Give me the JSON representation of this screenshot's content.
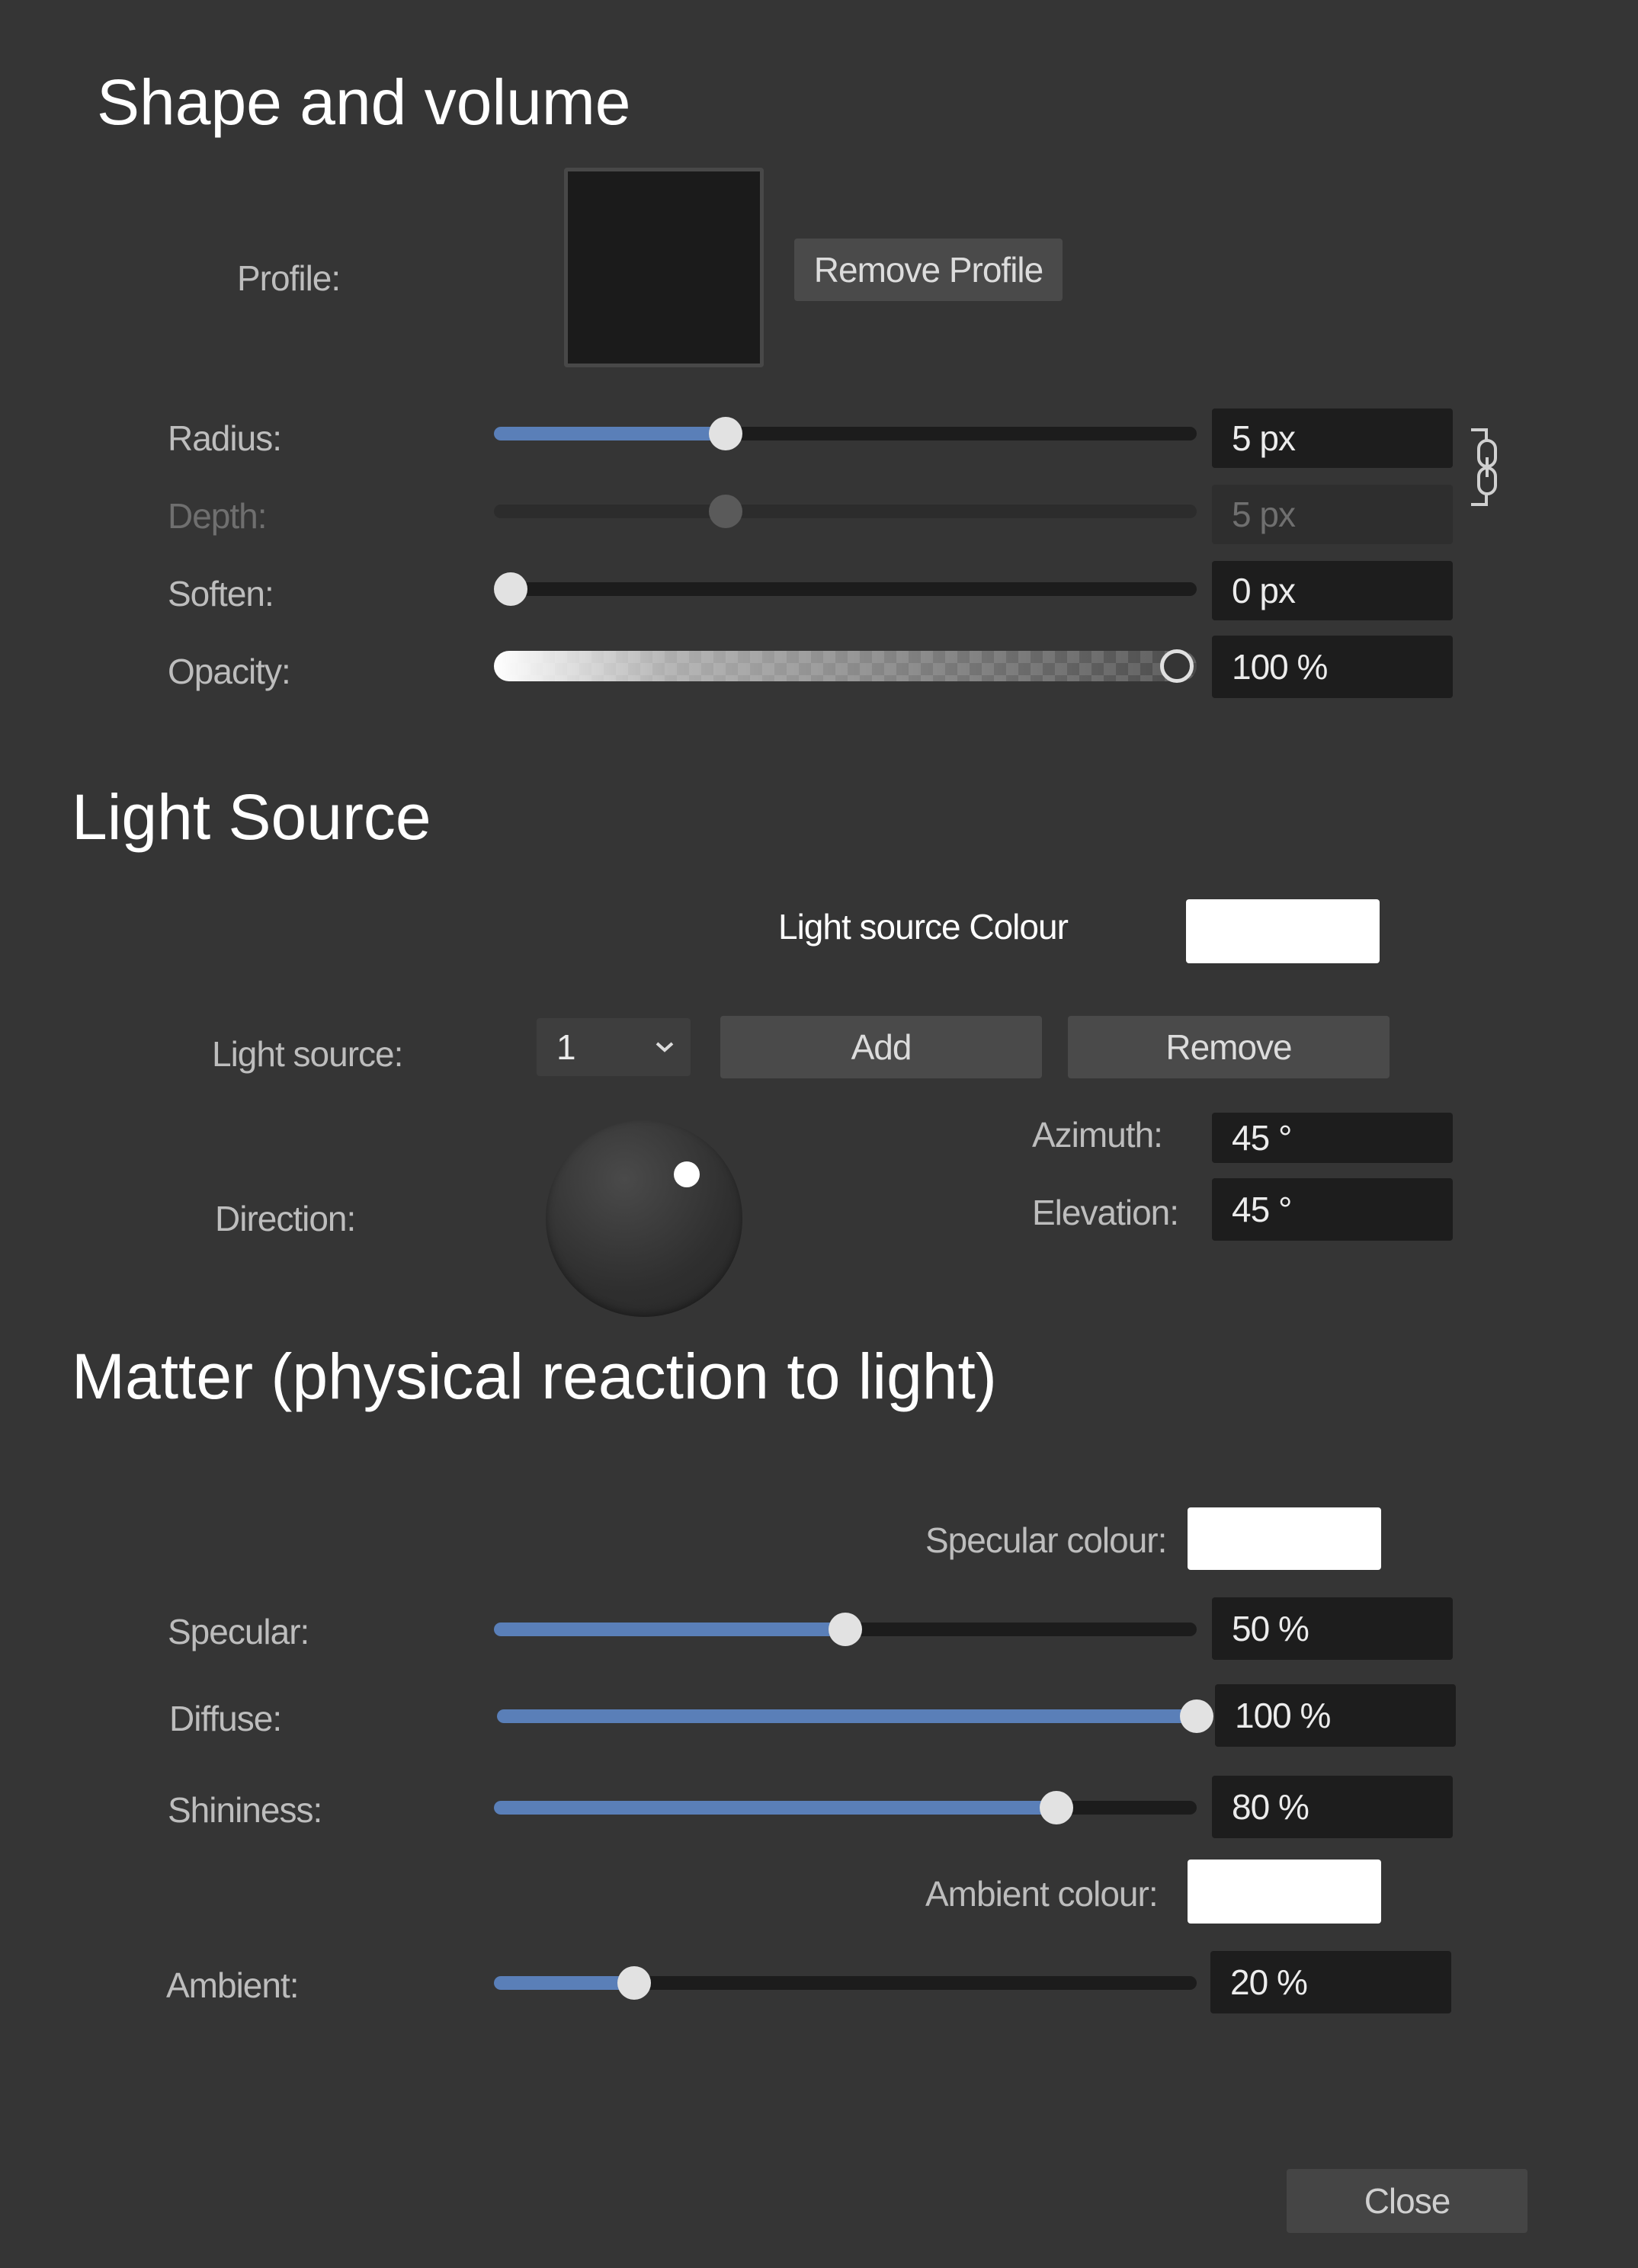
{
  "sections": {
    "shape": "Shape and volume",
    "light": "Light Source",
    "matter": "Matter (physical reaction to light)"
  },
  "profile": {
    "label": "Profile:",
    "remove_label": "Remove Profile"
  },
  "shape_sliders": [
    {
      "label": "Radius:",
      "value": "5 px",
      "level": 0.33,
      "enabled": true
    },
    {
      "label": "Depth:",
      "value": "5 px",
      "level": 0.33,
      "enabled": false
    },
    {
      "label": "Soften:",
      "value": "0 px",
      "level": 0.0,
      "enabled": true
    },
    {
      "label": "Opacity:",
      "value": "100 %",
      "level": 1.0,
      "enabled": true
    }
  ],
  "light": {
    "colour_label": "Light source Colour",
    "colour": "#ffffff",
    "source_label": "Light source:",
    "source_value": "1",
    "add_label": "Add",
    "remove_label": "Remove",
    "direction_label": "Direction:",
    "azimuth_label": "Azimuth:",
    "azimuth_value": "45 °",
    "elevation_label": "Elevation:",
    "elevation_value": "45 °"
  },
  "matter": {
    "specular_colour_label": "Specular colour:",
    "specular_colour": "#ffffff",
    "ambient_colour_label": "Ambient colour:",
    "ambient_colour": "#ffffff",
    "sliders": [
      {
        "label": "Specular:",
        "value": "50 %",
        "level": 0.5
      },
      {
        "label": "Diffuse:",
        "value": "100 %",
        "level": 1.0
      },
      {
        "label": "Shininess:",
        "value": "80 %",
        "level": 0.8
      },
      {
        "label": "Ambient:",
        "value": "20 %",
        "level": 0.2
      }
    ]
  },
  "close_label": "Close",
  "colors": {
    "accent": "#5a7fb8",
    "background": "#353535",
    "field": "#1d1d1d"
  },
  "icons": {
    "link": "chain-link-icon",
    "dropdown": "chevron-down-icon"
  }
}
